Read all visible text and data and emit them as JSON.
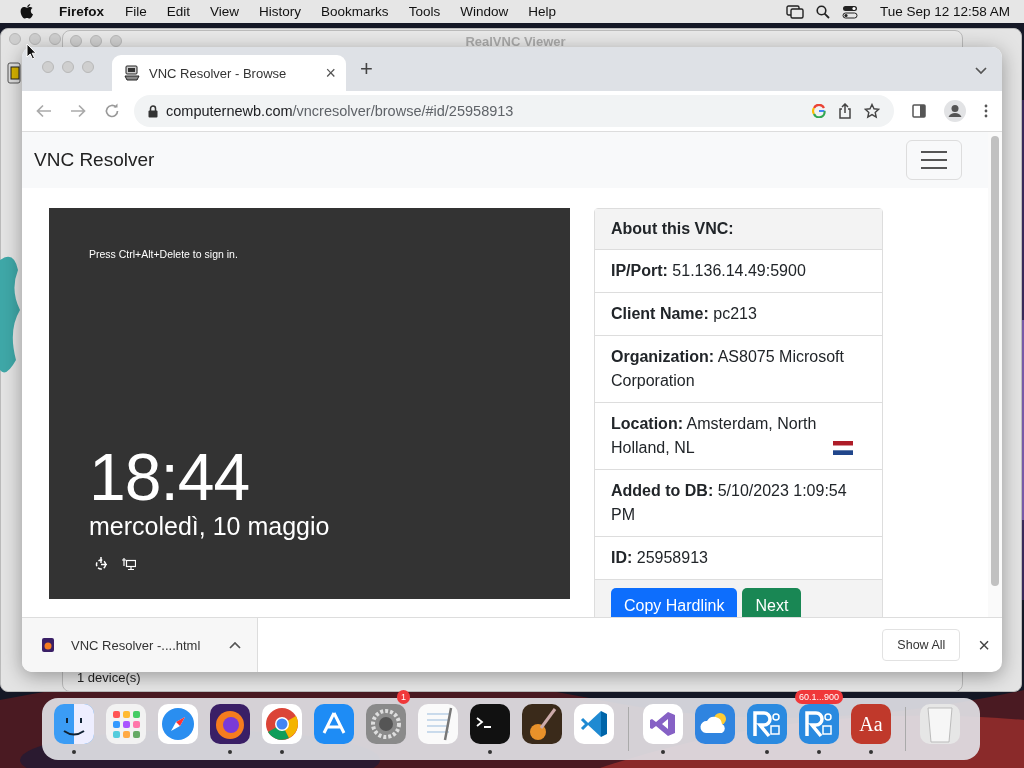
{
  "menubar": {
    "app": "Firefox",
    "menus": [
      "File",
      "Edit",
      "View",
      "History",
      "Bookmarks",
      "Tools",
      "Window",
      "Help"
    ],
    "clock": "Tue Sep 12  12:58 AM"
  },
  "back_window": {
    "title": "RealVNC Viewer",
    "status": "1 device(s)"
  },
  "browser": {
    "tab": {
      "title": "VNC Resolver - Browse",
      "close": "×",
      "selected": true
    },
    "new_tab": "+",
    "url": {
      "domain": "computernewb.com",
      "path": "/vncresolver/browse/#id/25958913"
    }
  },
  "page": {
    "brand": "VNC Resolver",
    "screen": {
      "hint": "Press Ctrl+Alt+Delete to sign in.",
      "time": "18:44",
      "date": "mercoledì, 10 maggio"
    },
    "card": {
      "header": "About this VNC:",
      "rows": [
        {
          "label": "IP/Port:",
          "value": "51.136.14.49:5900",
          "kind": "plain"
        },
        {
          "label": "Client Name:",
          "value": "pc213",
          "kind": "plain"
        },
        {
          "label": "Organization:",
          "value": "AS8075 Microsoft Corporation",
          "kind": "plain"
        },
        {
          "label": "Location:",
          "value": "Amsterdam, North Holland, NL",
          "kind": "flag"
        },
        {
          "label": "Added to DB:",
          "value": "5/10/2023 1:09:54 PM",
          "kind": "plain"
        },
        {
          "label": "ID:",
          "value": "25958913",
          "kind": "plain"
        }
      ],
      "buttons": [
        {
          "label": "Copy Hardlink",
          "kind": "primary"
        },
        {
          "label": "Next",
          "kind": "success"
        }
      ]
    }
  },
  "downloads": {
    "file": "VNC Resolver -....html",
    "show_all": "Show All",
    "close": "×"
  },
  "dock": {
    "apps": [
      {
        "kind": "face",
        "running": true
      },
      {
        "kind": "grid",
        "running": false
      },
      {
        "kind": "compass",
        "running": false
      },
      {
        "kind": "fox",
        "running": true
      },
      {
        "kind": "ball",
        "running": true
      },
      {
        "kind": "store",
        "running": false
      },
      {
        "kind": "gear",
        "running": false,
        "badge": "1"
      },
      {
        "kind": "paper",
        "running": false
      },
      {
        "kind": "terminal",
        "running": true
      },
      {
        "kind": "guitar",
        "running": false
      },
      {
        "kind": "code",
        "running": false
      },
      {
        "kind": "separator"
      },
      {
        "kind": "infinity",
        "running": true
      },
      {
        "kind": "cloud",
        "running": false
      },
      {
        "kind": "remote",
        "running": true
      },
      {
        "kind": "remote",
        "running": true,
        "badge": "60.1...900"
      },
      {
        "kind": "book",
        "running": true,
        "label": "Aa"
      },
      {
        "kind": "separator"
      },
      {
        "kind": "trash",
        "running": false
      }
    ]
  }
}
